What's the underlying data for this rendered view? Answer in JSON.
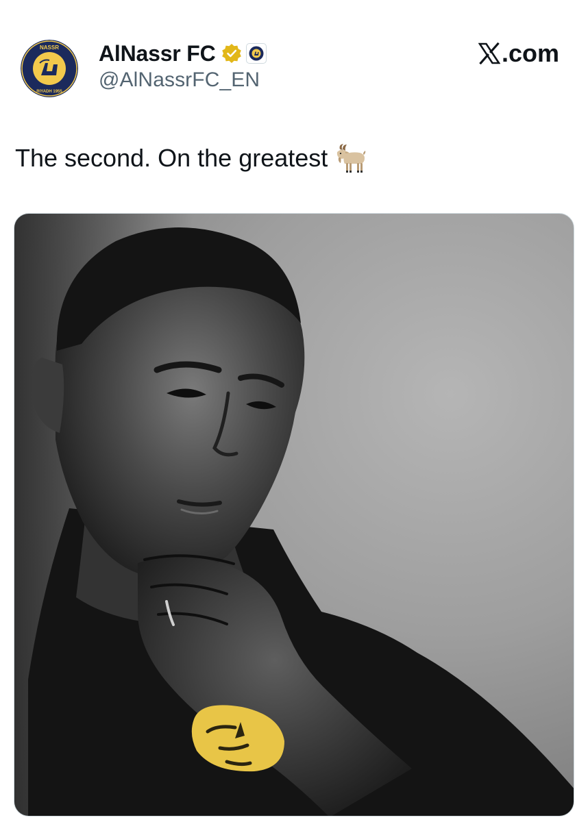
{
  "account": {
    "display_name": "AlNassr FC",
    "handle": "@AlNassrFC_EN",
    "avatar_icon": "alnassr-crest-icon",
    "verified_icon": "gold-verified-badge-icon",
    "affiliate_icon": "alnassr-affiliate-badge-icon"
  },
  "source": {
    "icon": "x-logo-icon",
    "label": ".com"
  },
  "tweet": {
    "text": "The second. On the greatest",
    "emoji_icon": "goat-emoji-icon"
  },
  "media": {
    "icon": "photo-player-portrait"
  },
  "colors": {
    "text_primary": "#0f1419",
    "text_secondary": "#536471",
    "crest_yellow": "#f2c94c",
    "crest_blue": "#1b2a5c",
    "verified_gold": "#e2b719"
  }
}
